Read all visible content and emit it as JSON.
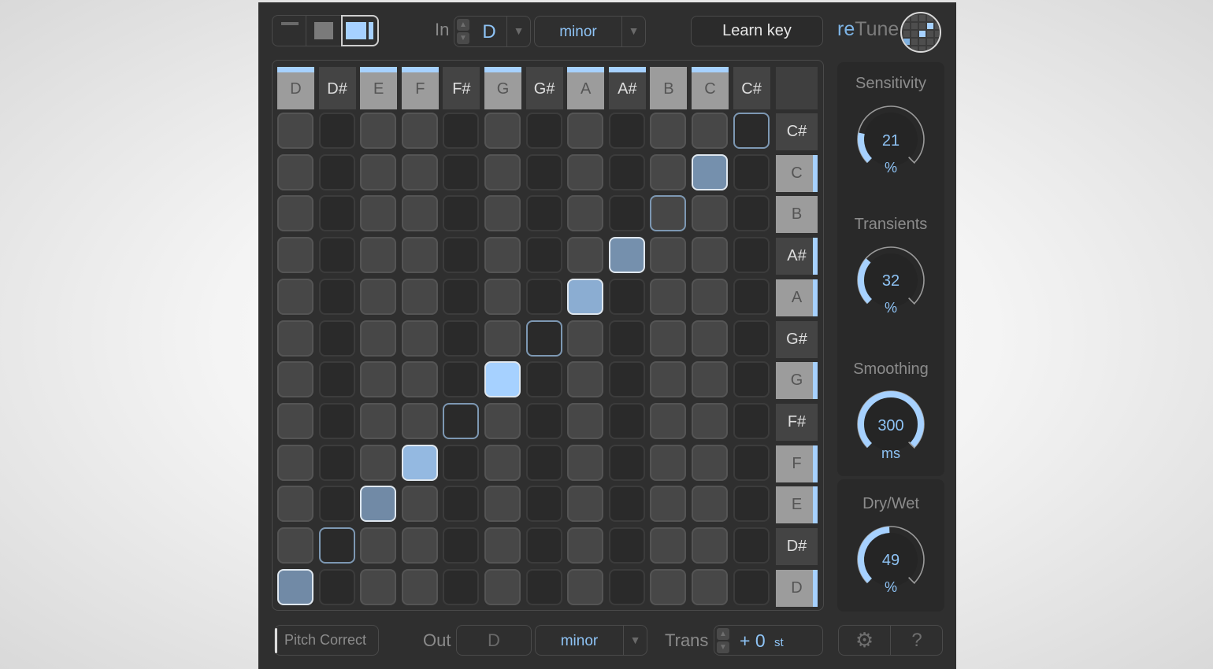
{
  "app": {
    "name_prefix": "re",
    "name_suffix": "Tune",
    "accent": "#a6d1ff",
    "value_color": "#8ec3f5"
  },
  "toolbar": {
    "view_modes": [
      {
        "name": "compact",
        "selected": false
      },
      {
        "name": "grid",
        "selected": false
      },
      {
        "name": "grid-with-panel",
        "selected": true
      }
    ],
    "in_label": "In",
    "in_key": "D",
    "in_scale": "minor",
    "learn_key_label": "Learn key",
    "spin_up": "▲",
    "spin_down": "▼",
    "dropdown_arrow": "▼"
  },
  "grid": {
    "columns": [
      {
        "note": "D",
        "shade": "light",
        "active": true
      },
      {
        "note": "D#",
        "shade": "dark",
        "active": false
      },
      {
        "note": "E",
        "shade": "light",
        "active": true
      },
      {
        "note": "F",
        "shade": "light",
        "active": true
      },
      {
        "note": "F#",
        "shade": "dark",
        "active": false
      },
      {
        "note": "G",
        "shade": "light",
        "active": true
      },
      {
        "note": "G#",
        "shade": "dark",
        "active": false
      },
      {
        "note": "A",
        "shade": "light",
        "active": true
      },
      {
        "note": "A#",
        "shade": "dark",
        "active": true
      },
      {
        "note": "B",
        "shade": "light",
        "active": false
      },
      {
        "note": "C",
        "shade": "light",
        "active": true
      },
      {
        "note": "C#",
        "shade": "dark",
        "active": false
      }
    ],
    "rows": [
      {
        "note": "C#",
        "shade": "dark",
        "active": false,
        "target_col": 11,
        "level": 0.0
      },
      {
        "note": "C",
        "shade": "light",
        "active": true,
        "target_col": 10,
        "level": 0.45
      },
      {
        "note": "B",
        "shade": "light",
        "active": false,
        "target_col": 9,
        "level": 0.0
      },
      {
        "note": "A#",
        "shade": "dark",
        "active": true,
        "target_col": 8,
        "level": 0.45
      },
      {
        "note": "A",
        "shade": "light",
        "active": true,
        "target_col": 7,
        "level": 0.7
      },
      {
        "note": "G#",
        "shade": "dark",
        "active": false,
        "target_col": 6,
        "level": 0.0
      },
      {
        "note": "G",
        "shade": "light",
        "active": true,
        "target_col": 5,
        "level": 1.0
      },
      {
        "note": "F#",
        "shade": "dark",
        "active": false,
        "target_col": 4,
        "level": 0.0
      },
      {
        "note": "F",
        "shade": "light",
        "active": true,
        "target_col": 3,
        "level": 0.8
      },
      {
        "note": "E",
        "shade": "light",
        "active": true,
        "target_col": 2,
        "level": 0.4
      },
      {
        "note": "D#",
        "shade": "dark",
        "active": false,
        "target_col": 1,
        "level": 0.0
      },
      {
        "note": "D",
        "shade": "light",
        "active": true,
        "target_col": 0,
        "level": 0.4
      }
    ]
  },
  "knobs": [
    {
      "title": "Sensitivity",
      "value": "21",
      "unit": "%",
      "fraction": 0.21
    },
    {
      "title": "Transients",
      "value": "32",
      "unit": "%",
      "fraction": 0.32
    },
    {
      "title": "Smoothing",
      "value": "300",
      "unit": "ms",
      "fraction": 1.0
    },
    {
      "title": "Dry/Wet",
      "value": "49",
      "unit": "%",
      "fraction": 0.49
    }
  ],
  "bottom": {
    "pitch_correct_label": "Pitch Correct",
    "out_label": "Out",
    "out_key": "D",
    "out_scale": "minor",
    "trans_label": "Trans",
    "trans_value": "+ 0",
    "trans_unit": "st",
    "settings_icon": "⚙",
    "help_label": "?"
  }
}
